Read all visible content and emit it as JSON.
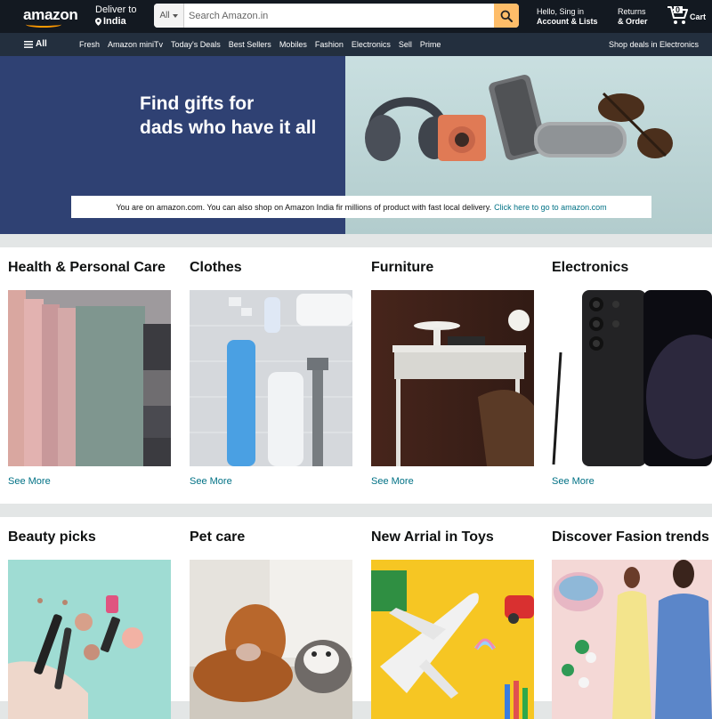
{
  "nav": {
    "logo": "amazon",
    "deliver_line1": "Deliver to",
    "deliver_line2": "India",
    "search_category": "All",
    "search_placeholder": "Search Amazon.in",
    "account_line1": "Hello, Sing in",
    "account_line2": "Account & Lists",
    "returns_line1": "Returns",
    "returns_line2": "& Order",
    "cart_label": "Cart",
    "cart_count": "0"
  },
  "subnav": {
    "all": "All",
    "items": [
      "Fresh",
      "Amazon miniTv",
      "Today's Deals",
      "Best Sellers",
      "Mobiles",
      "Fashion",
      "Electronics",
      "Sell",
      "Prime"
    ],
    "deal": "Shop deals in Electronics"
  },
  "hero": {
    "title": "Find gifts for\ndads who have it all",
    "notice_text": "You are on amazon.com. You can also shop on Amazon India fir millions of product with fast local delivery.",
    "notice_link": "Click here to go to amazon.com"
  },
  "row1": [
    {
      "title": "Health & Personal Care",
      "link": "See More"
    },
    {
      "title": "Clothes",
      "link": "See More"
    },
    {
      "title": "Furniture",
      "link": "See More"
    },
    {
      "title": "Electronics",
      "link": "See More"
    }
  ],
  "row2": [
    {
      "title": "Beauty picks"
    },
    {
      "title": "Pet care"
    },
    {
      "title": "New Arrial in Toys"
    },
    {
      "title": "Discover Fasion trends"
    }
  ],
  "colors": {
    "nav_bg": "#131921",
    "subnav_bg": "#232f3e",
    "accent": "#febd69",
    "link": "#007185",
    "hero_left": "#2f4173"
  }
}
